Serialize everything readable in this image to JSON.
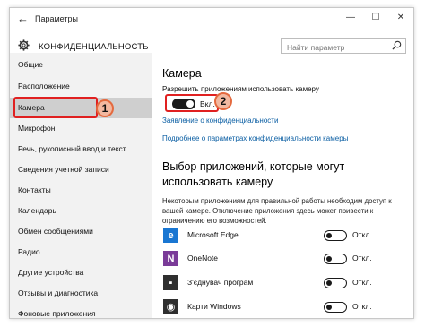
{
  "window": {
    "back_arrow": "←",
    "title": "Параметры",
    "controls": {
      "minimize": "—",
      "maximize": "☐",
      "close": "✕"
    }
  },
  "header": {
    "title": "КОНФИДЕНЦИАЛЬНОСТЬ",
    "search_placeholder": "Найти параметр"
  },
  "sidebar": {
    "items": [
      {
        "label": "Общие"
      },
      {
        "label": "Расположение"
      },
      {
        "label": "Камера",
        "selected": true
      },
      {
        "label": "Микрофон"
      },
      {
        "label": "Речь, рукописный ввод и текст"
      },
      {
        "label": "Сведения учетной записи"
      },
      {
        "label": "Контакты"
      },
      {
        "label": "Календарь"
      },
      {
        "label": "Обмен сообщениями"
      },
      {
        "label": "Радио"
      },
      {
        "label": "Другие устройства"
      },
      {
        "label": "Отзывы и диагностика"
      },
      {
        "label": "Фоновые приложения"
      }
    ]
  },
  "content": {
    "heading": "Камера",
    "camera_permission_label": "Разрешить приложениям использовать камеру",
    "camera_toggle_state": "Вкл.",
    "privacy_statement_link": "Заявление о конфиденциальности",
    "more_info_link": "Подробнее о параметрах конфиденциальности камеры",
    "apps_heading": "Выбор приложений, которые могут использовать камеру",
    "apps_description": "Некоторым приложениям для правильной работы необходим доступ к вашей камере. Отключение приложения здесь может привести к ограничению его возможностей.",
    "apps": [
      {
        "name": "Microsoft Edge",
        "state": "Откл.",
        "icon": "edge-icon",
        "color": "#1976d2",
        "glyph": "e"
      },
      {
        "name": "OneNote",
        "state": "Откл.",
        "icon": "onenote-icon",
        "color": "#7a3b98",
        "glyph": "N"
      },
      {
        "name": "З'єднувач програм",
        "state": "Откл.",
        "icon": "app-connector-icon",
        "color": "#2f2f2f",
        "glyph": "▪"
      },
      {
        "name": "Карти Windows",
        "state": "Откл.",
        "icon": "maps-icon",
        "color": "#2f2f2f",
        "glyph": "◉"
      }
    ]
  },
  "annotations": {
    "badge1": "1",
    "badge2": "2",
    "color": "#e02020"
  },
  "colors": {
    "link": "#0a5ea3",
    "sidebar_bg": "#f2f2f2",
    "selected_bg": "#cfcfcf"
  }
}
